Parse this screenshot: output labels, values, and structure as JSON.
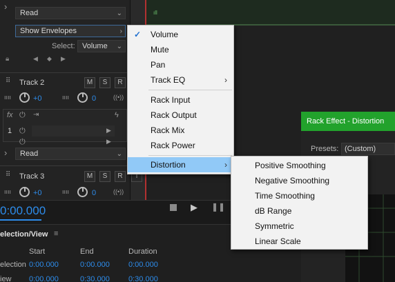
{
  "left": {
    "read_top": "Read",
    "show_envelopes": "Show Envelopes",
    "select_label": "Select:",
    "select_value": "Volume",
    "track2": {
      "name": "Track 2",
      "vol": "+0",
      "pan": "0"
    },
    "fx_slot": "1",
    "read_mid": "Read",
    "track3": {
      "name": "Track 3",
      "vol": "+0",
      "pan": "0"
    },
    "btn_m": "M",
    "btn_s": "S",
    "btn_r": "R",
    "btn_i": "I"
  },
  "transport": {
    "time": "0:00.000"
  },
  "selection": {
    "title": "election/View",
    "cols": [
      "Start",
      "End",
      "Duration"
    ],
    "rows": [
      {
        "label": "election",
        "start": "0:00.000",
        "end": "0:00.000",
        "duration": "0:00.000"
      },
      {
        "label": "iew",
        "start": "0:00.000",
        "end": "0:30.000",
        "duration": "0:30.000"
      }
    ]
  },
  "rack": {
    "title": "Rack Effect - Distortion",
    "presets_label": "Presets:",
    "presets_value": "(Custom)"
  },
  "menu1": {
    "items": [
      {
        "label": "Volume",
        "checked": true
      },
      {
        "label": "Mute"
      },
      {
        "label": "Pan"
      },
      {
        "label": "Track EQ",
        "submenu": true
      },
      {
        "label": "Rack Input"
      },
      {
        "label": "Rack Output"
      },
      {
        "label": "Rack Mix"
      },
      {
        "label": "Rack Power"
      },
      {
        "label": "Distortion",
        "submenu": true,
        "highlighted": true
      }
    ]
  },
  "menu2": {
    "items": [
      {
        "label": "Positive Smoothing"
      },
      {
        "label": "Negative Smoothing"
      },
      {
        "label": "Time Smoothing"
      },
      {
        "label": "dB Range"
      },
      {
        "label": "Symmetric"
      },
      {
        "label": "Linear Scale"
      }
    ]
  },
  "colors": {
    "accent": "#2d8ceb",
    "rack_header": "#22a22c",
    "menu_highlight": "#91c9f7",
    "playhead": "#b33131"
  }
}
